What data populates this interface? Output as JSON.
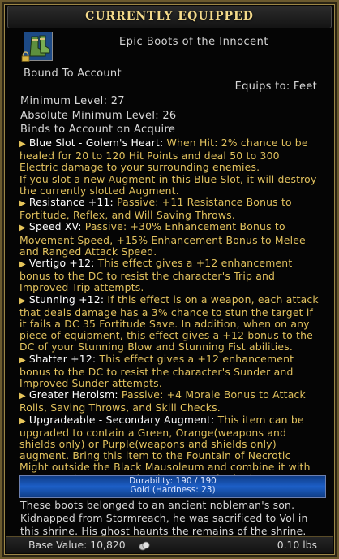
{
  "header": {
    "title": "Currently Equipped"
  },
  "item": {
    "icon": "boots-icon",
    "locked_icon": "lock-icon",
    "name": "Epic Boots of the Innocent",
    "bound": "Bound To Account",
    "equips_to": "Equips to: Feet",
    "min_level": "Minimum Level: 27",
    "abs_min_level": "Absolute Minimum Level: 26",
    "binds": "Binds to Account on Acquire"
  },
  "effects": [
    {
      "name": "Blue Slot - Golem's Heart:",
      "desc": "When Hit: 2% chance to be healed for 20 to 120 Hit Points and deal 50 to 300 Electric damage to your surrounding enemies.",
      "desc2": "If you slot a new Augment in this Blue Slot, it will destroy the currently slotted Augment."
    },
    {
      "name": "Resistance +11:",
      "desc": "Passive: +11 Resistance Bonus to Fortitude, Reflex, and Will Saving Throws."
    },
    {
      "name": "Speed XV:",
      "desc": "Passive: +30% Enhancement Bonus to Movement Speed, +15% Enhancement Bonus to Melee and Ranged Attack Speed."
    },
    {
      "name": "Vertigo +12:",
      "desc": "This effect gives a +12 enhancement bonus to the DC to resist the character's Trip and Improved Trip attempts."
    },
    {
      "name": "Stunning +12:",
      "desc": "If this effect is on a weapon, each attack that deals damage has a 3% chance to stun the target if it fails a DC 35 Fortitude Save. In addition, when on any piece of equipment, this effect gives a +12 bonus to the DC of your Stunning Blow and Stunning Fist abilities."
    },
    {
      "name": "Shatter +12:",
      "desc": "This effect gives a +12 enhancement bonus to the DC to resist the character's Sunder and Improved Sunder attempts."
    },
    {
      "name": "Greater Heroism:",
      "desc": "Passive: +4 Morale Bonus to Attack Rolls, Saving Throws, and Skill Checks."
    },
    {
      "name": "Upgradeable - Secondary Augment:",
      "desc": "This item can be upgraded to contain a Green, Orange(weapons and shields only) or Purple(weapons and shields only) augment. Bring this item to the Fountain of Necrotic Might outside the Black Mausoleum and combine it with Masterwork Tapestry Shreds to upgrade the item."
    }
  ],
  "durability": {
    "text": "Durability: 190 / 190",
    "material": "Gold (Hardness: 23)",
    "fill": 1.0
  },
  "flavor": "These boots belonged to an ancient nobleman's son. Kidnapped from Stormreach, he was sacrificed to Vol in this shrine. His ghost haunts the remains of the shrine.",
  "footer": {
    "base_value": "Base Value: 10,820",
    "coin_icon": "coin-icon",
    "weight": "0.10 lbs"
  },
  "colors": {
    "title": "#f3d98a",
    "effect_name": "#ffffff",
    "effect_desc": "#e2c25e",
    "bar": "#1d5fc7",
    "border": "#9c8646"
  }
}
